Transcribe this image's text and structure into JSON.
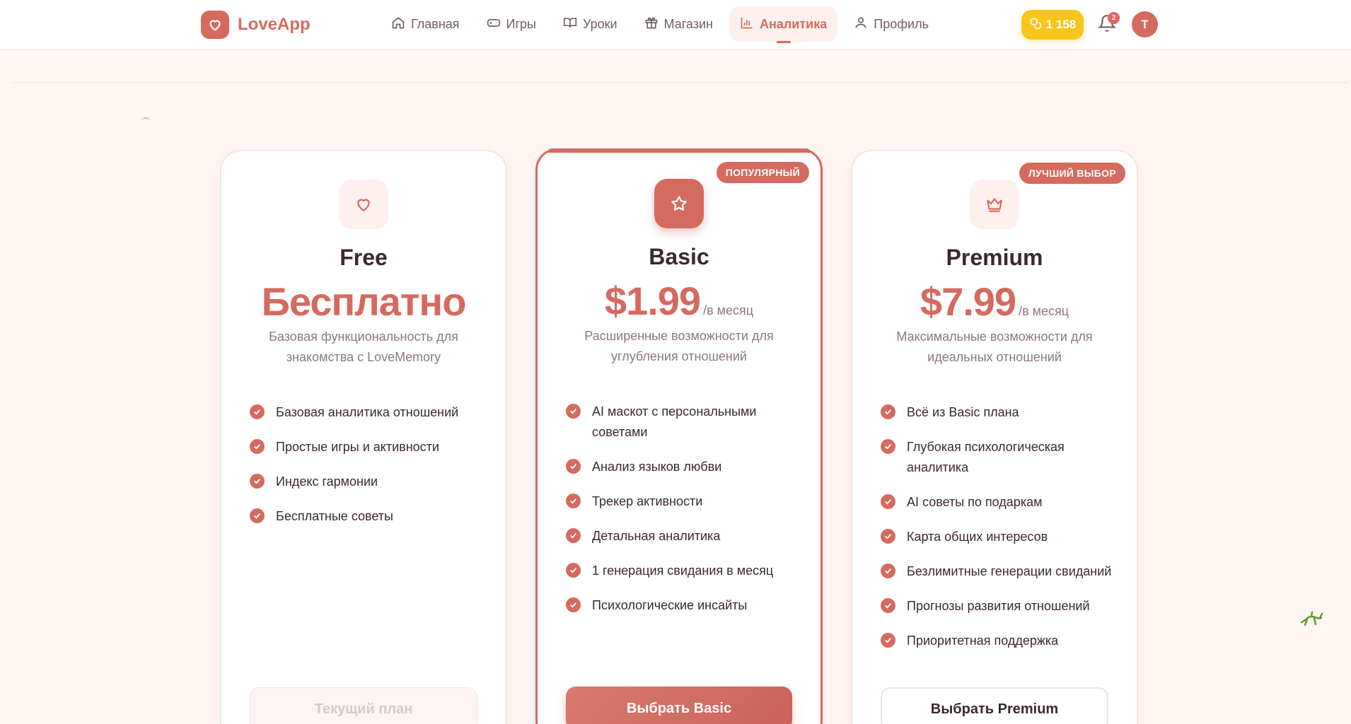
{
  "app": {
    "name": "LoveApp"
  },
  "nav": {
    "items": [
      {
        "label": "Главная",
        "icon": "home-icon"
      },
      {
        "label": "Игры",
        "icon": "gamepad-icon"
      },
      {
        "label": "Уроки",
        "icon": "book-icon"
      },
      {
        "label": "Магазин",
        "icon": "gift-icon"
      },
      {
        "label": "Аналитика",
        "icon": "bar-chart-icon",
        "active": true
      },
      {
        "label": "Профиль",
        "icon": "user-icon"
      }
    ]
  },
  "header": {
    "coins": "1 158",
    "notifications_count": "2",
    "avatar_initial": "T"
  },
  "plans": [
    {
      "name": "Free",
      "price": "Бесплатно",
      "period": "",
      "badge": "",
      "icon": "heart-icon",
      "description": "Базовая функциональность для знакомства с LoveMemory",
      "features": [
        "Базовая аналитика отношений",
        "Простые игры и активности",
        "Индекс гармонии",
        "Бесплатные советы"
      ],
      "button": "Текущий план"
    },
    {
      "name": "Basic",
      "price": "$1.99",
      "period": "/в месяц",
      "badge": "ПОПУЛЯРНЫЙ",
      "icon": "star-icon",
      "description": "Расширенные возможности для углубления отношений",
      "features": [
        "AI маскот с персональными советами",
        "Анализ языков любви",
        "Трекер активности",
        "Детальная аналитика",
        "1 генерация свидания в месяц",
        "Психологические инсайты"
      ],
      "button": "Выбрать Basic"
    },
    {
      "name": "Premium",
      "price": "$7.99",
      "period": "/в месяц",
      "badge": "ЛУЧШИЙ ВЫБОР",
      "icon": "crown-icon",
      "description": "Максимальные возможности для идеальных отношений",
      "features": [
        "Всё из Basic плана",
        "Глубокая психологическая аналитика",
        "AI советы по подаркам",
        "Карта общих интересов",
        "Безлимитные генерации свиданий",
        "Прогнозы развития отношений",
        "Приоритетная поддержка"
      ],
      "button": "Выбрать Premium"
    }
  ],
  "colors": {
    "accent": "#d56a5e",
    "coins": "#f7c51b",
    "background": "#fff5f3"
  }
}
